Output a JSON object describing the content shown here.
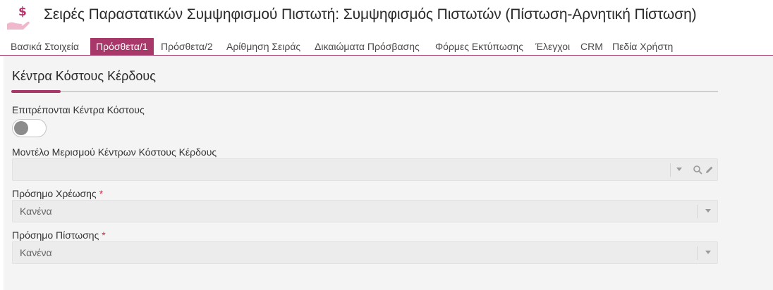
{
  "header": {
    "logo_icon": "hand-dollar-icon",
    "title": "Σειρές Παραστατικών Συμψηφισμού Πιστωτή: Συμψηφισμός Πιστωτών (Πίστωση-Αρνητική Πίστωση)"
  },
  "tabs": [
    {
      "label": "Βασικά Στοιχεία",
      "active": false
    },
    {
      "label": "Πρόσθετα/1",
      "active": true
    },
    {
      "label": "Πρόσθετα/2",
      "active": false
    },
    {
      "label": "Αρίθμηση Σειράς",
      "active": false
    },
    {
      "label": "Δικαιώματα Πρόσβασης",
      "active": false
    },
    {
      "label": "Φόρμες Εκτύπωσης",
      "active": false
    },
    {
      "label": "Έλεγχοι",
      "active": false
    },
    {
      "label": "CRM",
      "active": false
    },
    {
      "label": "Πεδία Χρήστη",
      "active": false
    }
  ],
  "section": {
    "title": "Κέντρα Κόστους Κέρδους"
  },
  "fields": {
    "allow_cost_centers": {
      "label": "Επιτρέπονται Κέντρα Κόστους",
      "value": false
    },
    "allocation_model": {
      "label": "Μοντέλο Μερισμού Κέντρων Κόστους Κέρδους",
      "value": "",
      "icons": [
        "chevron-down-icon",
        "search-icon",
        "pencil-icon"
      ]
    },
    "debit_sign": {
      "label": "Πρόσημο Χρέωσης",
      "required_mark": "*",
      "value": "Κανένα",
      "icon": "chevron-down-icon"
    },
    "credit_sign": {
      "label": "Πρόσημο Πίστωσης",
      "required_mark": "*",
      "value": "Κανένα",
      "icon": "chevron-down-icon"
    }
  },
  "colors": {
    "accent": "#a8386a",
    "required": "#c0304a",
    "logo": "#b8336a"
  }
}
